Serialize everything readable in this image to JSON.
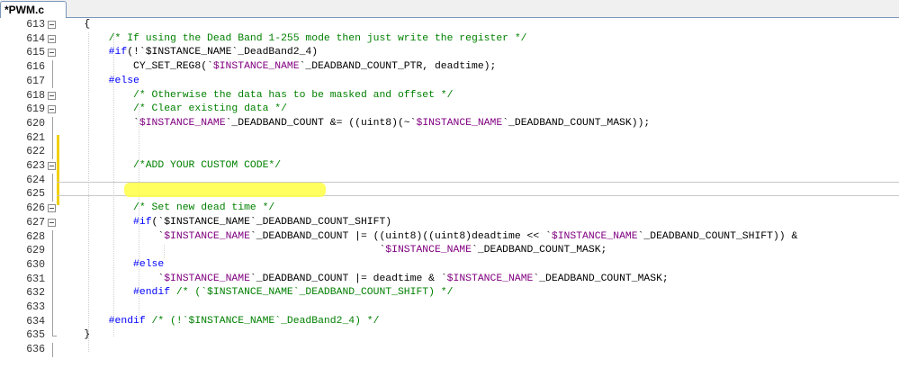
{
  "tab": {
    "title": "*PWM.c"
  },
  "lines": [
    {
      "num": "613",
      "parts": [
        {
          "t": "    {",
          "c": ""
        }
      ]
    },
    {
      "num": "614",
      "parts": [
        {
          "t": "        /* If using the Dead Band 1-255 mode then just write the register */",
          "c": "cm"
        }
      ]
    },
    {
      "num": "615",
      "parts": [
        {
          "t": "        #if",
          "c": "kw"
        },
        {
          "t": "(!`$INSTANCE_NAME`_DeadBand2_4)",
          "c": ""
        }
      ]
    },
    {
      "num": "616",
      "parts": [
        {
          "t": "            CY_SET_REG8(`",
          "c": ""
        },
        {
          "t": "$INSTANCE_NAME",
          "c": "mc"
        },
        {
          "t": "`_DEADBAND_COUNT_PTR, deadtime);",
          "c": ""
        }
      ]
    },
    {
      "num": "617",
      "parts": [
        {
          "t": "        #else",
          "c": "kw"
        }
      ]
    },
    {
      "num": "618",
      "parts": [
        {
          "t": "            /* Otherwise the data has to be masked and offset */",
          "c": "cm"
        }
      ]
    },
    {
      "num": "619",
      "parts": [
        {
          "t": "            /* Clear existing data */",
          "c": "cm"
        }
      ]
    },
    {
      "num": "620",
      "parts": [
        {
          "t": "            `",
          "c": ""
        },
        {
          "t": "$INSTANCE_NAME",
          "c": "mc"
        },
        {
          "t": "`_DEADBAND_COUNT &= ((uint8)(~`",
          "c": ""
        },
        {
          "t": "$INSTANCE_NAME",
          "c": "mc"
        },
        {
          "t": "`_DEADBAND_COUNT_MASK));",
          "c": ""
        }
      ]
    },
    {
      "num": "621",
      "parts": []
    },
    {
      "num": "622",
      "parts": []
    },
    {
      "num": "623",
      "parts": [
        {
          "t": "            /*ADD YOUR CUSTOM CODE*/",
          "c": "cm"
        }
      ]
    },
    {
      "num": "624",
      "parts": []
    },
    {
      "num": "625",
      "parts": []
    },
    {
      "num": "626",
      "parts": [
        {
          "t": "            /* Set new dead time */",
          "c": "cm"
        }
      ]
    },
    {
      "num": "627",
      "parts": [
        {
          "t": "            #if",
          "c": "kw"
        },
        {
          "t": "(`$INSTANCE_NAME`_DEADBAND_COUNT_SHIFT)",
          "c": ""
        }
      ]
    },
    {
      "num": "628",
      "parts": [
        {
          "t": "                `",
          "c": ""
        },
        {
          "t": "$INSTANCE_NAME",
          "c": "mc"
        },
        {
          "t": "`_DEADBAND_COUNT |= ((uint8)((uint8)deadtime << `",
          "c": ""
        },
        {
          "t": "$INSTANCE_NAME",
          "c": "mc"
        },
        {
          "t": "`_DEADBAND_COUNT_SHIFT)) &",
          "c": ""
        }
      ]
    },
    {
      "num": "629",
      "parts": [
        {
          "t": "                                                    `",
          "c": ""
        },
        {
          "t": "$INSTANCE_NAME",
          "c": "mc"
        },
        {
          "t": "`_DEADBAND_COUNT_MASK;",
          "c": ""
        }
      ]
    },
    {
      "num": "630",
      "parts": [
        {
          "t": "            #else",
          "c": "kw"
        }
      ]
    },
    {
      "num": "631",
      "parts": [
        {
          "t": "                `",
          "c": ""
        },
        {
          "t": "$INSTANCE_NAME",
          "c": "mc"
        },
        {
          "t": "`_DEADBAND_COUNT |= deadtime & `",
          "c": ""
        },
        {
          "t": "$INSTANCE_NAME",
          "c": "mc"
        },
        {
          "t": "`_DEADBAND_COUNT_MASK;",
          "c": ""
        }
      ]
    },
    {
      "num": "632",
      "parts": [
        {
          "t": "            #endif",
          "c": "kw"
        },
        {
          "t": " /* (`$INSTANCE_NAME`_DEADBAND_COUNT_SHIFT) */",
          "c": "cm"
        }
      ]
    },
    {
      "num": "633",
      "parts": []
    },
    {
      "num": "634",
      "parts": [
        {
          "t": "        #endif",
          "c": "kw"
        },
        {
          "t": " /* (!`$INSTANCE_NAME`_DeadBand2_4) */",
          "c": "cm"
        }
      ]
    },
    {
      "num": "635",
      "parts": [
        {
          "t": "    }",
          "c": ""
        }
      ]
    },
    {
      "num": "636",
      "parts": []
    }
  ],
  "colors": {
    "comment": "#008000",
    "keyword": "#0000ff",
    "macro": "#800080",
    "highlight": "#ffff44"
  }
}
